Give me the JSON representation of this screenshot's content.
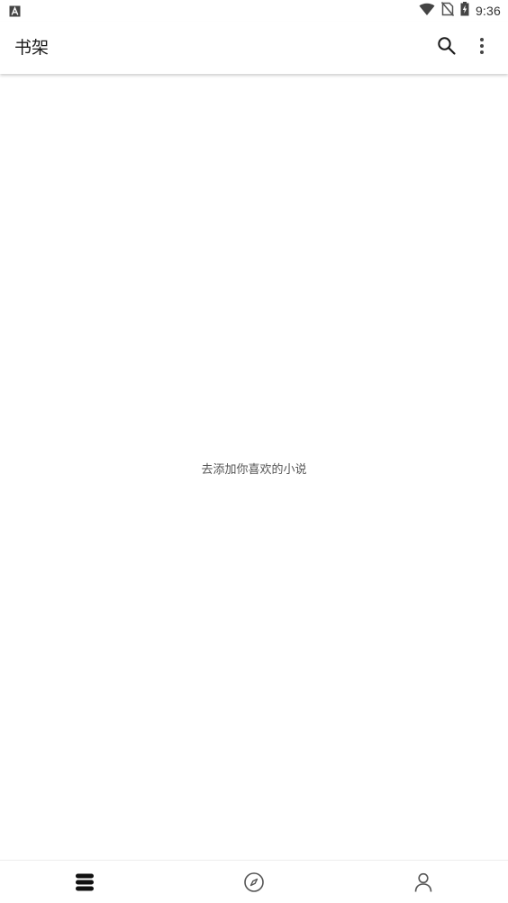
{
  "status_bar": {
    "time": "9:36",
    "left_icon": "a-notification-icon",
    "icons": [
      "wifi-icon",
      "no-sim-icon",
      "battery-charging-icon"
    ]
  },
  "app_bar": {
    "title": "书架",
    "actions": [
      "search-icon",
      "more-vert-icon"
    ]
  },
  "content": {
    "empty_message": "去添加你喜欢的小说"
  },
  "bottom_nav": {
    "items": [
      {
        "icon": "bookshelf-icon",
        "selected": true
      },
      {
        "icon": "compass-icon",
        "selected": false
      },
      {
        "icon": "person-icon",
        "selected": false
      }
    ]
  },
  "colors": {
    "text_primary": "#1a1a1a",
    "text_secondary": "#555555",
    "icon_active": "#111111",
    "icon_inactive": "#555555"
  }
}
